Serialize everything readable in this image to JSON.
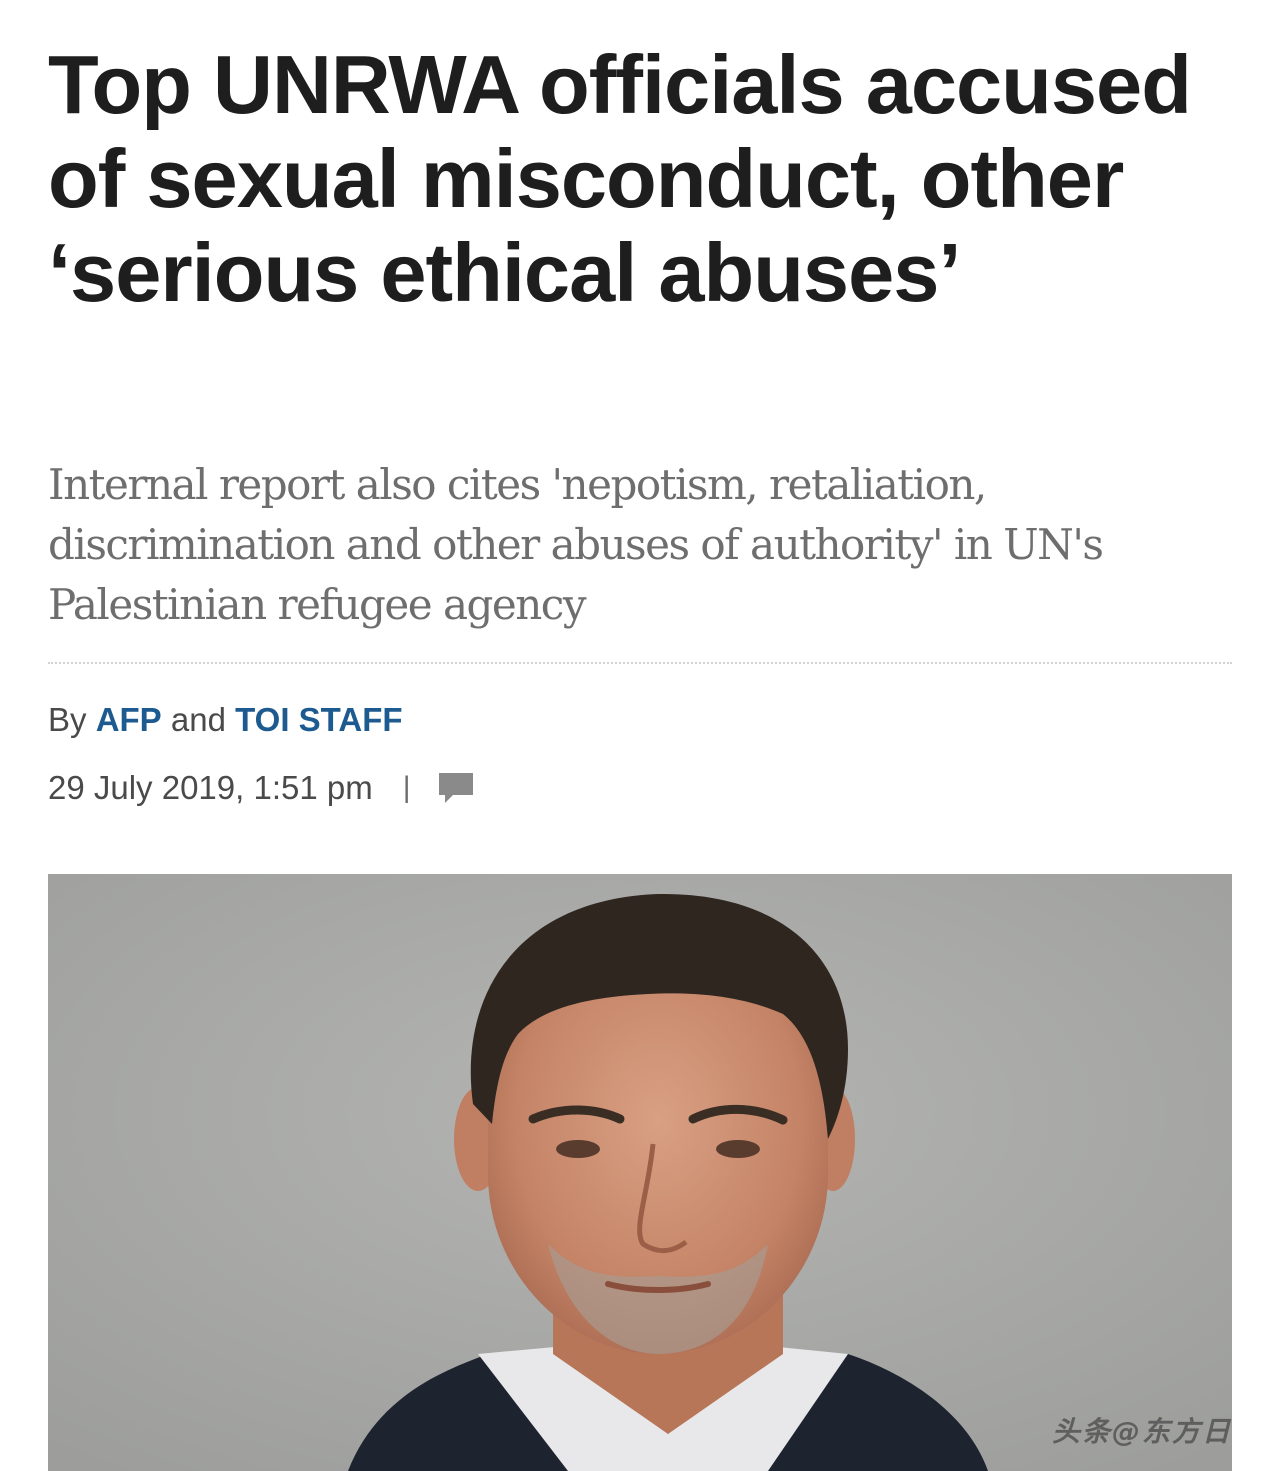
{
  "article": {
    "headline": "Top UNRWA officials accused of sexual misconduct, other ‘serious ethical abuses’",
    "subtitle": "Internal report also cites 'nepotism, retaliation, discrimination and other abuses of authority' in UN's Palestinian refugee agency",
    "byline": {
      "prefix": "By",
      "author_1": "AFP",
      "joiner": "and",
      "author_2": "TOI STAFF"
    },
    "timestamp": "29 July 2019, 1:51 pm",
    "separator": "|",
    "comment_icon": "comment-bubble-icon",
    "watermark": "头条@东方日"
  },
  "colors": {
    "headline": "#1e1e1e",
    "subtitle": "#6e6e6e",
    "author_link": "#1d5a8f",
    "meta_text": "#4a4a4a",
    "photo_background": "#a9aaa8"
  }
}
